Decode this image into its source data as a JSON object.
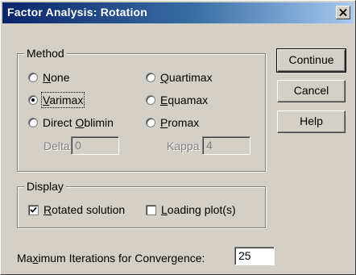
{
  "window": {
    "title": "Factor Analysis: Rotation",
    "close_glyph": "✕"
  },
  "method": {
    "legend": "Method",
    "options": [
      {
        "label": "None",
        "mnemonic": "N",
        "selected": false
      },
      {
        "label": "Varimax",
        "mnemonic": "V",
        "selected": true
      },
      {
        "label": "Direct Oblimin",
        "mnemonic": "O",
        "selected": false
      },
      {
        "label": "Quartimax",
        "mnemonic": "Q",
        "selected": false
      },
      {
        "label": "Equamax",
        "mnemonic": "E",
        "selected": false
      },
      {
        "label": "Promax",
        "mnemonic": "P",
        "selected": false
      }
    ],
    "delta": {
      "label": "Delta:",
      "value": "0",
      "enabled": false
    },
    "kappa": {
      "label": "Kappa",
      "value": "4",
      "enabled": false
    }
  },
  "display": {
    "legend": "Display",
    "rotated_solution": {
      "label": "Rotated solution",
      "checked": true
    },
    "loading_plots": {
      "label": "Loading plot(s)",
      "checked": false
    }
  },
  "iterations": {
    "label": "Maximum Iterations for Convergence:",
    "value": "25"
  },
  "buttons": {
    "continue": "Continue",
    "cancel": "Cancel",
    "help": "Help"
  },
  "icons": {
    "close": "close-icon",
    "check": "checkmark-icon"
  },
  "colors": {
    "face": "#d4d0c8",
    "title_start": "#0a246a",
    "title_end": "#a6caf0",
    "disabled_text": "#808080"
  }
}
